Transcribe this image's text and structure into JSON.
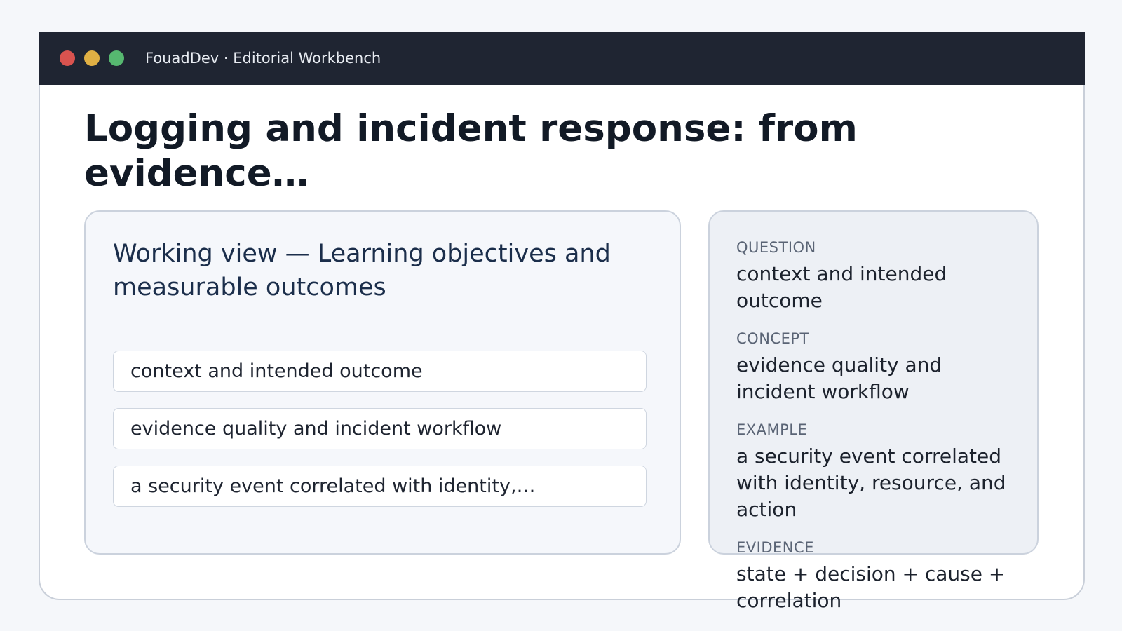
{
  "window": {
    "app_title": "FouadDev · Editorial Workbench"
  },
  "page": {
    "title": "Logging and incident response: from evidence…"
  },
  "main_card": {
    "heading": "Working view — Learning objectives and measurable outcomes",
    "items": [
      "context and intended outcome",
      "evidence quality and incident workflow",
      "a security event correlated with identity,…"
    ]
  },
  "side_card": {
    "facts": [
      {
        "label": "QUESTION",
        "value": "context and intended outcome"
      },
      {
        "label": "CONCEPT",
        "value": "evidence quality and incident workflow"
      },
      {
        "label": "EXAMPLE",
        "value": "a security event correlated with identity, resource, and action"
      },
      {
        "label": "EVIDENCE",
        "value": "state + decision + cause + correlation"
      }
    ]
  }
}
